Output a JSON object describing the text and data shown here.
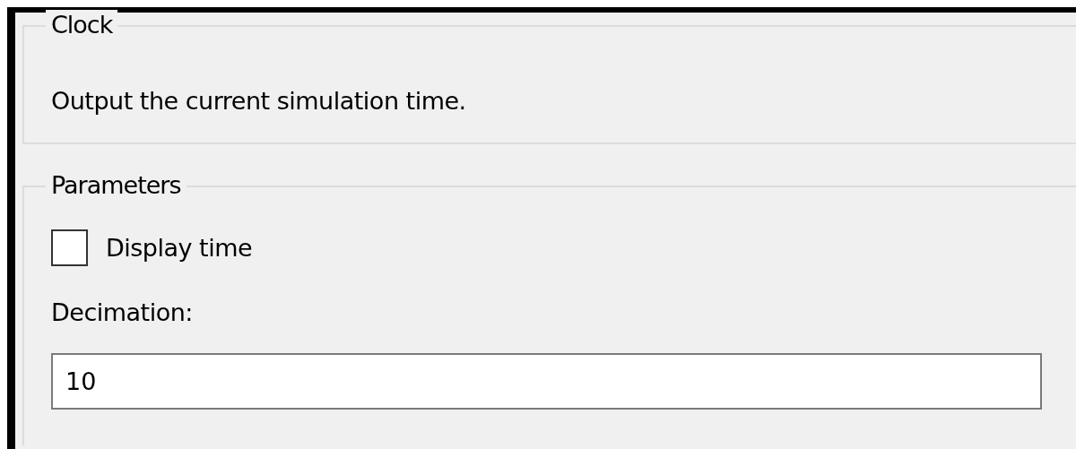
{
  "block": {
    "title": "Clock",
    "description": "Output the current simulation time."
  },
  "parameters": {
    "title": "Parameters",
    "checkbox": {
      "label": "Display time",
      "checked": false
    },
    "field": {
      "label": "Decimation:",
      "value": "10"
    }
  }
}
